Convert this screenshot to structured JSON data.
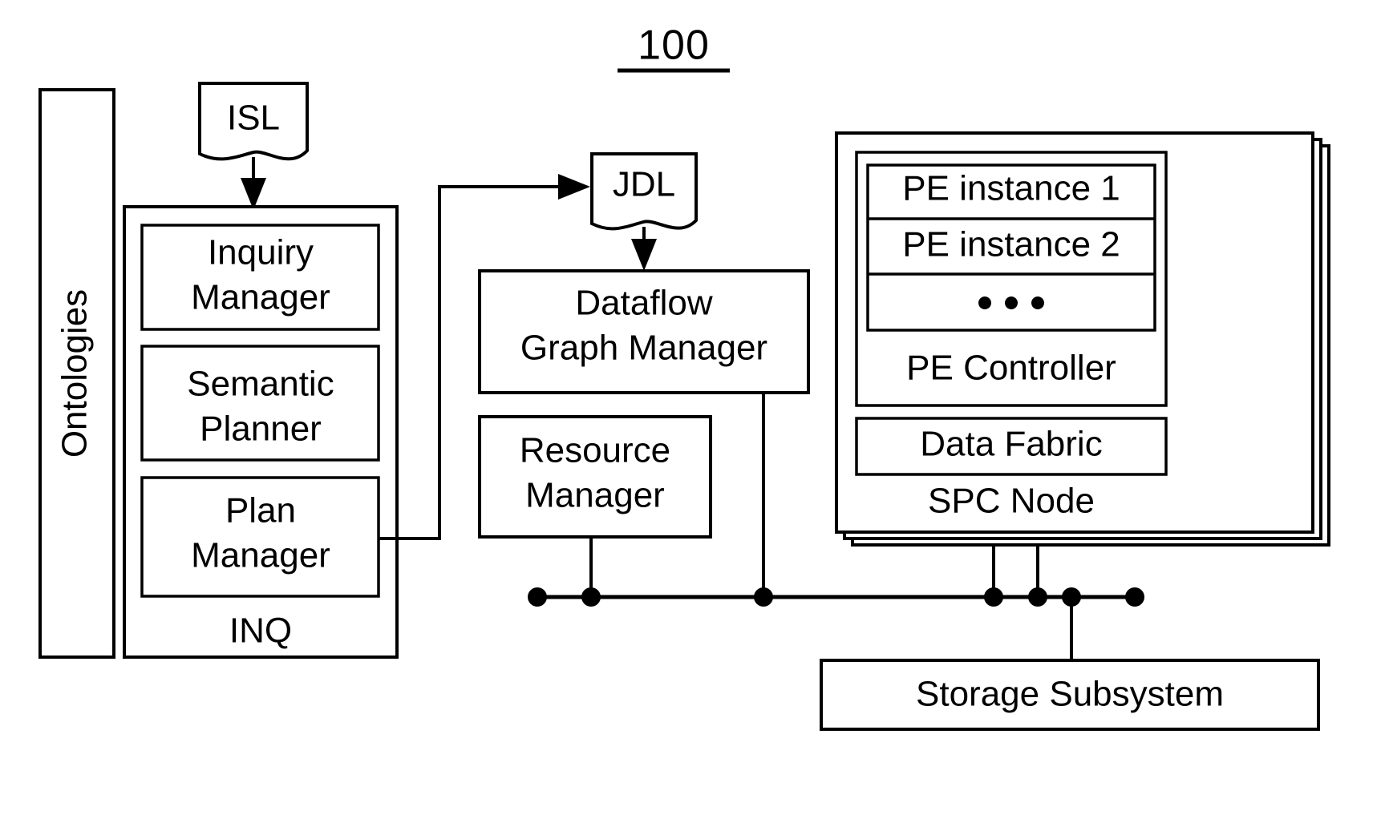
{
  "figure": {
    "number": "100",
    "underline": true
  },
  "nodes": {
    "ontologies": {
      "label": "Ontologies",
      "rotated": true
    },
    "isl": {
      "label": "ISL",
      "shape": "document"
    },
    "jdl": {
      "label": "JDL",
      "shape": "document"
    },
    "inq": {
      "label": "INQ",
      "children": [
        {
          "label": "Inquiry Manager",
          "line1": "Inquiry",
          "line2": "Manager"
        },
        {
          "label": "Semantic Planner",
          "line1": "Semantic",
          "line2": "Planner"
        },
        {
          "label": "Plan Manager",
          "line1": "Plan",
          "line2": "Manager"
        }
      ]
    },
    "dataflow_graph_manager": {
      "label": "Dataflow Graph Manager",
      "line1": "Dataflow",
      "line2": "Graph Manager"
    },
    "resource_manager": {
      "label": "Resource Manager",
      "line1": "Resource",
      "line2": "Manager"
    },
    "spc_node": {
      "label": "SPC Node",
      "stacked": true,
      "pe_controller": {
        "label": "PE Controller",
        "instances": [
          {
            "label": "PE instance 1"
          },
          {
            "label": "PE instance 2"
          },
          {
            "label": "• • •",
            "is_ellipsis": true
          }
        ]
      },
      "data_fabric": {
        "label": "Data Fabric"
      }
    },
    "storage_subsystem": {
      "label": "Storage Subsystem"
    }
  },
  "connections": [
    {
      "from": "isl",
      "to": "inquiry-manager",
      "arrow": true
    },
    {
      "from": "plan-manager",
      "to": "jdl",
      "arrow": true
    },
    {
      "from": "jdl",
      "to": "dataflow-graph-manager",
      "arrow": true
    },
    {
      "from": "resource-manager",
      "to": "bus",
      "arrow": false
    },
    {
      "from": "dataflow-graph-manager",
      "to": "bus",
      "arrow": false
    },
    {
      "from": "spc-node",
      "to": "bus",
      "arrow": false
    },
    {
      "from": "bus",
      "to": "storage-subsystem",
      "arrow": false
    }
  ],
  "bus": {
    "dot_count": 6,
    "label": ""
  },
  "colors": {
    "line": "#000000",
    "fill": "#ffffff",
    "background": "#ffffff"
  }
}
